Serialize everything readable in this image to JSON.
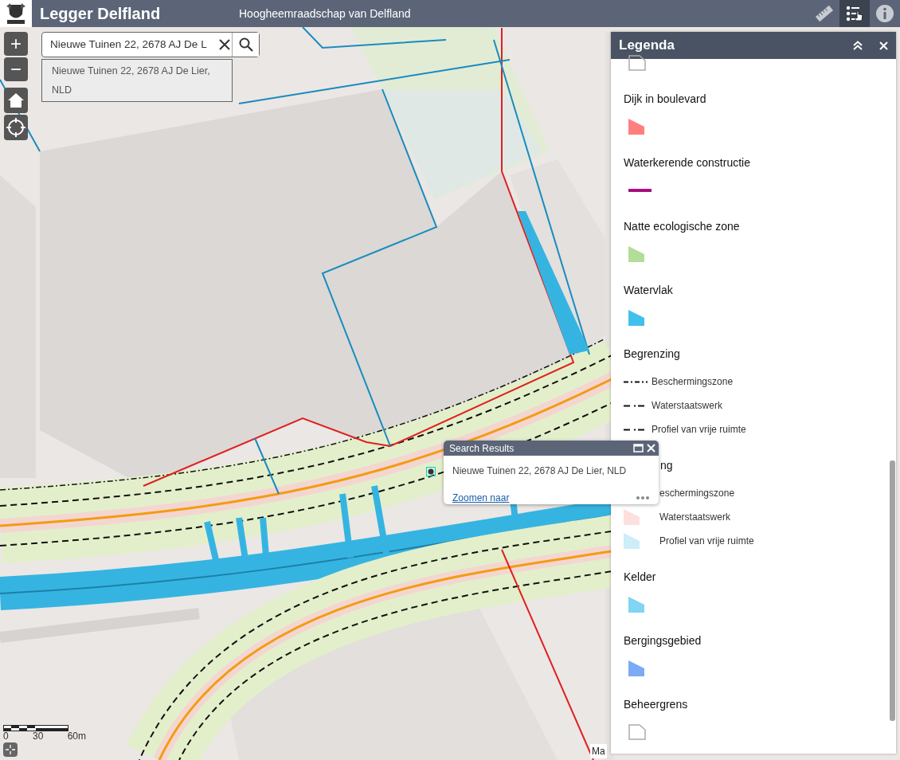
{
  "header": {
    "title": "Legger Delfland",
    "subtitle": "Hoogheemraadschap van Delfland",
    "tools": [
      {
        "kind": "ruler",
        "selected": false
      },
      {
        "kind": "legend",
        "selected": true
      },
      {
        "kind": "info",
        "selected": false
      }
    ]
  },
  "map_controls": {
    "zoom_in": "+",
    "zoom_out": "−"
  },
  "search": {
    "value": "Nieuwe Tuinen 22, 2678 AJ De L",
    "suggestions": [
      "Nieuwe Tuinen 22, 2678 AJ De Lier, NLD"
    ]
  },
  "popup": {
    "title": "Search Results",
    "text": "Nieuwe Tuinen 22, 2678 AJ De Lier, NLD",
    "link": "Zoomen naar"
  },
  "scale_bar": {
    "labels": [
      "0",
      "30",
      "60m"
    ]
  },
  "attribution": "Ma",
  "legend": {
    "title": "Legenda",
    "groups": [
      {
        "items": [
          {
            "kind": "outline"
          }
        ]
      },
      {
        "title": "Dijk in boulevard",
        "items": [
          {
            "kind": "polygon",
            "color": "#ff7f7f"
          }
        ]
      },
      {
        "title": "Waterkerende constructie",
        "items": [
          {
            "kind": "line",
            "color": "#a8087f"
          }
        ]
      },
      {
        "title": "Natte ecologische zone",
        "items": [
          {
            "kind": "polygon",
            "color": "#b3dd98"
          }
        ]
      },
      {
        "title": "Watervlak",
        "items": [
          {
            "kind": "polygon",
            "color": "#42c0ed"
          }
        ]
      },
      {
        "title": "Begrenzing",
        "items": [
          {
            "kind": "dashdot",
            "label": "Beschermingszone"
          },
          {
            "kind": "dash",
            "label": "Waterstaatswerk"
          },
          {
            "kind": "dash",
            "label": "Profiel van vrije ruimte"
          }
        ]
      },
      {
        "title": "ng",
        "covered": true,
        "items": [
          {
            "label": "eschermingszone"
          },
          {
            "kind": "polygon",
            "color": "#fde0dd",
            "label": "Waterstaatswerk"
          },
          {
            "kind": "polygon",
            "color": "#cdedf8",
            "label": "Profiel van vrije ruimte"
          }
        ]
      },
      {
        "title": "Kelder",
        "items": [
          {
            "kind": "polygon",
            "color": "#7fd5f3"
          }
        ]
      },
      {
        "title": "Bergingsgebied",
        "items": [
          {
            "kind": "polygon",
            "color": "#7daaf6"
          }
        ]
      },
      {
        "title": "Beheergrens",
        "items": [
          {
            "kind": "outline"
          }
        ]
      }
    ]
  }
}
